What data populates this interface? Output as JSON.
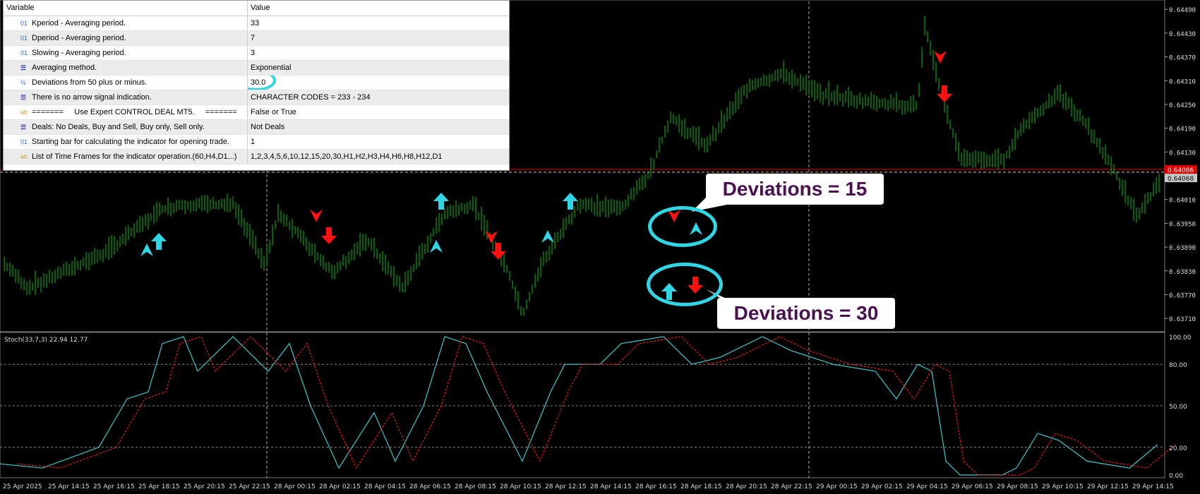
{
  "params": {
    "headers": {
      "variable": "Variable",
      "value": "Value"
    },
    "rows": [
      {
        "icon": "int",
        "label": "Kperiod - Averaging period.",
        "value": "33"
      },
      {
        "icon": "int",
        "label": "Dperiod - Averaging period.",
        "value": "7"
      },
      {
        "icon": "int",
        "label": "Slowing - Averaging period.",
        "value": "3"
      },
      {
        "icon": "enum",
        "label": "Averaging method.",
        "value": "Exponential"
      },
      {
        "icon": "half",
        "label": "Deviations from 50 plus or minus.",
        "value": "30.0"
      },
      {
        "icon": "enum",
        "label": "There is no arrow signal indication.",
        "value": "CHARACTER CODES = 233 - 234"
      },
      {
        "icon": "str",
        "label": "=======     Use Expert CONTROL DEAL MT5.     =======",
        "value": "False or True"
      },
      {
        "icon": "enum",
        "label": "Deals: No Deals, Buy and Sell, Buy only, Sell only.",
        "value": "Not Deals"
      },
      {
        "icon": "int",
        "label": "Starting bar for calculating the indicator for opening trade.",
        "value": "1"
      },
      {
        "icon": "str",
        "label": "List of Time Frames for the indicator operation.(60,H4,D1...)",
        "value": "1,2,3,4,5,6,10,12,15,20,30,H1,H2,H3,H4,H6,H8,H12,D1"
      }
    ],
    "icon_glyphs": {
      "int": "01",
      "half": "½",
      "enum": "☰",
      "str": "ab"
    }
  },
  "callouts": {
    "dev15": "Deviations = 15",
    "dev30": "Deviations = 30"
  },
  "price_axis": {
    "ticks": [
      "0.64490",
      "0.64430",
      "0.64370",
      "0.64310",
      "0.64250",
      "0.64190",
      "0.64130",
      "0.64010",
      "0.63950",
      "0.63890",
      "0.63830",
      "0.63770",
      "0.63710"
    ],
    "current_red": "0.64086",
    "current_gray": "0.64068"
  },
  "stoch": {
    "label": "Stoch(33,7,3) 22.94 12.77",
    "levels": [
      "100.00",
      "80.00",
      "50.00",
      "20.00",
      "0.00"
    ]
  },
  "time_axis": [
    "25 Apr 2025",
    "25 Apr 14:15",
    "25 Apr 16:15",
    "25 Apr 18:15",
    "25 Apr 20:15",
    "25 Apr 22:15",
    "28 Apr 00:15",
    "28 Apr 02:15",
    "28 Apr 04:15",
    "28 Apr 06:15",
    "28 Apr 08:15",
    "28 Apr 10:15",
    "28 Apr 12:15",
    "28 Apr 14:15",
    "28 Apr 16:15",
    "28 Apr 18:15",
    "28 Apr 20:15",
    "28 Apr 22:15",
    "29 Apr 00:15",
    "29 Apr 02:15",
    "29 Apr 04:15",
    "29 Apr 06:15",
    "29 Apr 08:15",
    "29 Apr 10:15",
    "29 Apr 12:15",
    "29 Apr 14:15"
  ],
  "colors": {
    "bars": "#00c800",
    "stoch_main": "#3cc8d2",
    "stoch_signal": "#e81c1c",
    "buy_arrow": "#2fd6e6",
    "sell_arrow": "#ff1010",
    "price_line": "#e00000",
    "highlight": "#2fd6e6"
  },
  "icons": [
    "up-arrow-icon",
    "down-arrow-icon",
    "buy-cursor-icon",
    "sell-cursor-icon"
  ]
}
